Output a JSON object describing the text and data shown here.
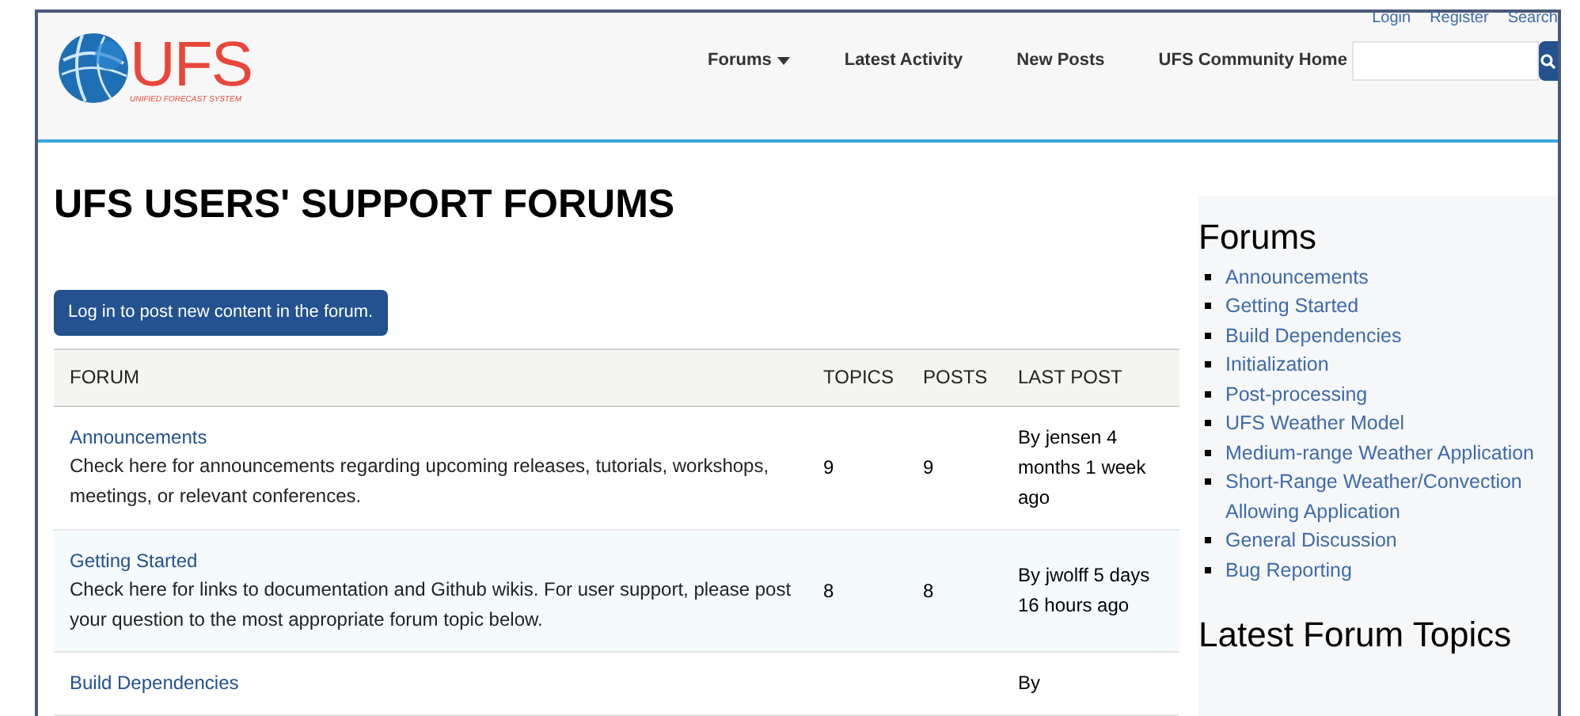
{
  "logo": {
    "wordmark": "UFS",
    "tagline": "UNIFIED FORECAST SYSTEM"
  },
  "user_links": [
    "Login",
    "Register",
    "Search"
  ],
  "nav": [
    {
      "label": "Forums",
      "dropdown": true
    },
    {
      "label": "Latest Activity",
      "dropdown": false
    },
    {
      "label": "New Posts",
      "dropdown": false
    },
    {
      "label": "UFS Community Home",
      "dropdown": false
    }
  ],
  "page_title": "UFS USERS' SUPPORT FORUMS",
  "post_button": "Log in to post new content in the forum.",
  "table": {
    "columns": [
      "FORUM",
      "TOPICS",
      "POSTS",
      "LAST POST"
    ],
    "rows": [
      {
        "title": "Announcements",
        "description": "Check here for announcements regarding upcoming releases, tutorials, workshops, meetings, or relevant conferences.",
        "topics": "9",
        "posts": "9",
        "last_post": "By jensen 4 months 1 week ago"
      },
      {
        "title": "Getting Started",
        "description": "Check here for links to documentation and Github wikis. For user support, please post your question to the most appropriate forum topic below.",
        "topics": "8",
        "posts": "8",
        "last_post": "By jwolff 5 days 16 hours ago"
      },
      {
        "title": "Build Dependencies",
        "last_post": "By"
      }
    ]
  },
  "sidebar": {
    "heading": "Forums",
    "items": [
      "Announcements",
      "Getting Started",
      "Build Dependencies",
      "Initialization",
      "Post-processing",
      "UFS Weather Model",
      "Medium-range Weather Application",
      "Short-Range Weather/Convection Allowing Application",
      "General Discussion",
      "Bug Reporting"
    ],
    "heading_2": "Latest Forum Topics"
  }
}
